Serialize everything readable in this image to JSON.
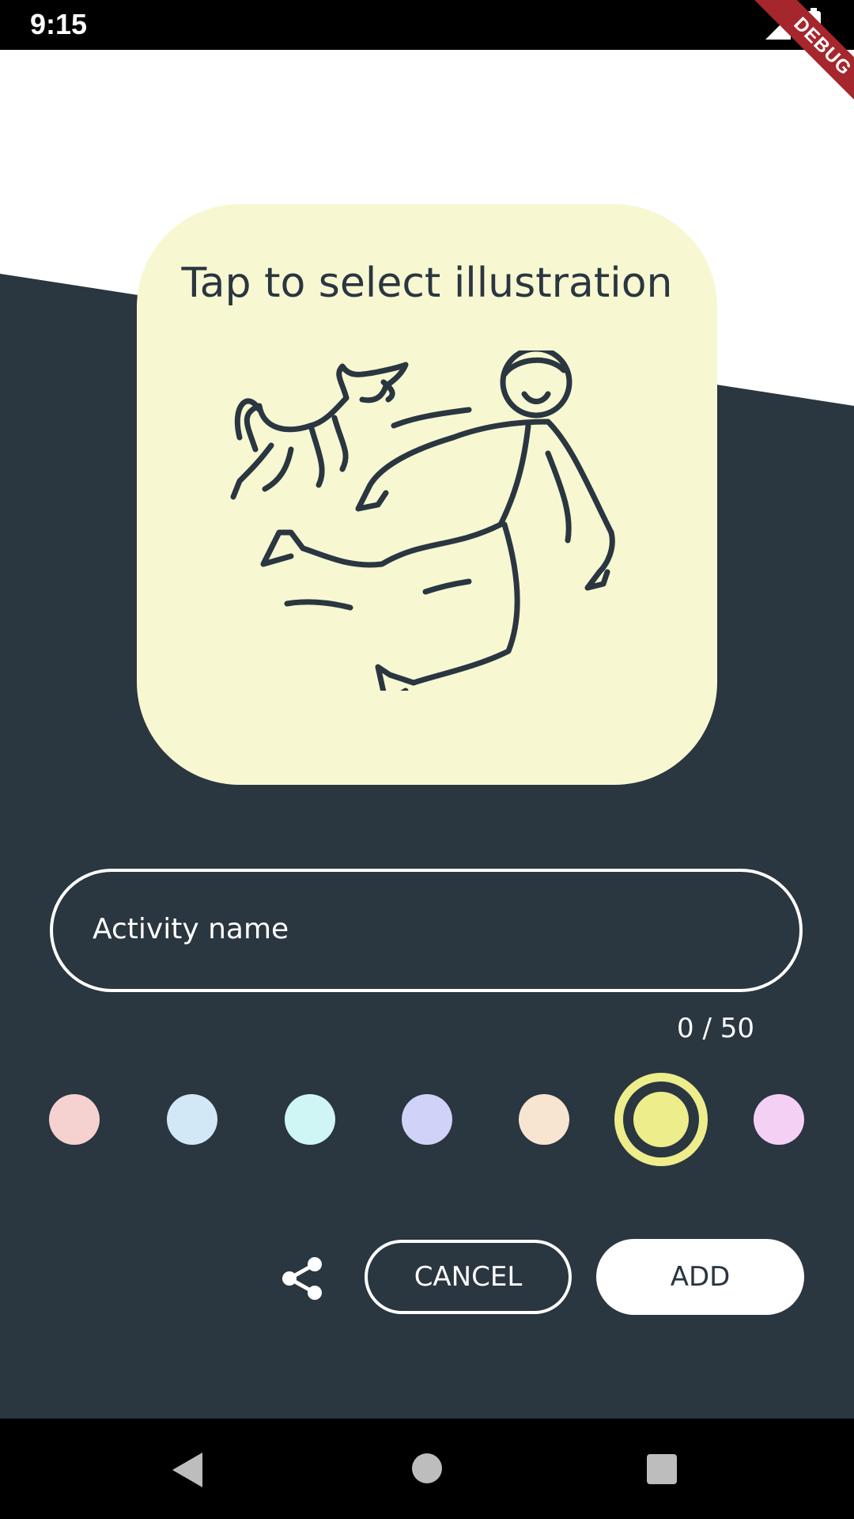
{
  "status_bar": {
    "time": "9:15"
  },
  "debug_banner": "DEBUG",
  "card": {
    "title": "Tap to select illustration",
    "background": "#f7f8d2"
  },
  "form": {
    "name_placeholder": "Activity name",
    "counter": "0 / 50"
  },
  "colors": [
    {
      "name": "pink",
      "hex": "#f5d2cf",
      "selected": false
    },
    {
      "name": "light-blue",
      "hex": "#d3e8f7",
      "selected": false
    },
    {
      "name": "cyan",
      "hex": "#cff6f5",
      "selected": false
    },
    {
      "name": "lavender",
      "hex": "#d0d2f8",
      "selected": false
    },
    {
      "name": "peach",
      "hex": "#f7e5d2",
      "selected": false
    },
    {
      "name": "yellow",
      "hex": "#eeed8b",
      "selected": true
    },
    {
      "name": "magenta",
      "hex": "#f5d0f5",
      "selected": false
    }
  ],
  "actions": {
    "cancel_label": "CANCEL",
    "add_label": "ADD"
  },
  "theme": {
    "dark": "#2a3640",
    "white": "#ffffff"
  }
}
